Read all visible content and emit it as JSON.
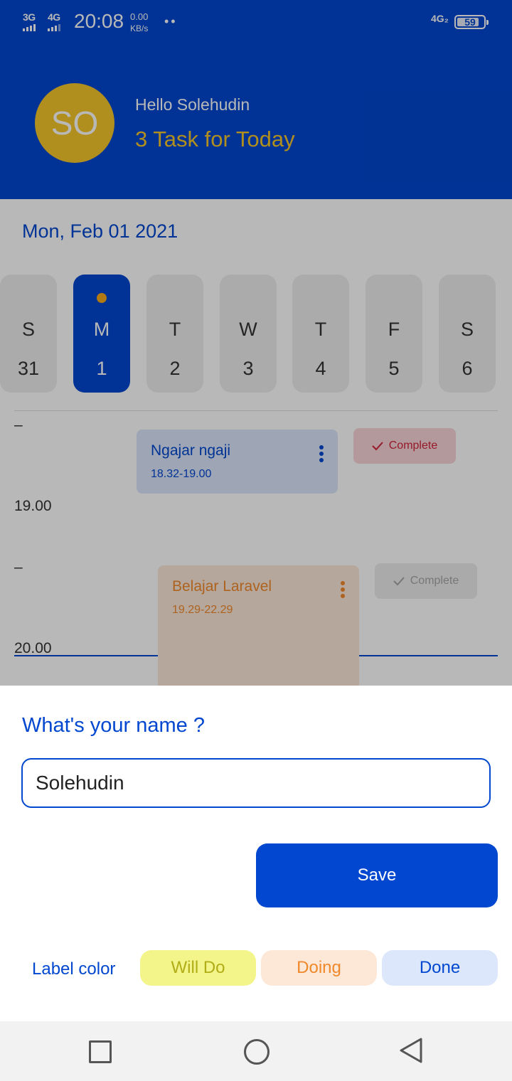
{
  "status_bar": {
    "network1": "3G",
    "network2": "4G",
    "time": "20:08",
    "speed_value": "0.00",
    "speed_unit": "KB/s",
    "dots": "••",
    "network_right": "4G₂",
    "battery": "59"
  },
  "header": {
    "avatar_initials": "SO",
    "greeting": "Hello Solehudin",
    "task_count_text": "3 Task for Today",
    "avatar_color": "#f6c62a",
    "background_color": "#0147cf"
  },
  "calendar": {
    "date_title": "Mon, Feb 01 2021",
    "days": [
      {
        "name": "S",
        "date": "31",
        "active": false
      },
      {
        "name": "M",
        "date": "1",
        "active": true
      },
      {
        "name": "T",
        "date": "2",
        "active": false
      },
      {
        "name": "W",
        "date": "3",
        "active": false
      },
      {
        "name": "T",
        "date": "4",
        "active": false
      },
      {
        "name": "F",
        "date": "5",
        "active": false
      },
      {
        "name": "S",
        "date": "6",
        "active": false
      }
    ]
  },
  "timeline": {
    "dash1": "–",
    "label_19": "19.00",
    "dash2": "–",
    "label_20": "20.00"
  },
  "tasks": [
    {
      "title": "Ngajar ngaji",
      "time": "18.32-19.00",
      "status_label": "Complete",
      "color": "#0147cf"
    },
    {
      "title": "Belajar Laravel",
      "time": "19.29-22.29",
      "status_label": "Complete",
      "color": "#f0892b"
    }
  ],
  "dialog": {
    "question": "What's your name ?",
    "name_value": "Solehudin",
    "save_label": "Save",
    "label_color_text": "Label color",
    "chips": {
      "will_do": "Will Do",
      "doing": "Doing",
      "done": "Done"
    }
  },
  "icons": {
    "checkmark": "check-icon",
    "more": "more-vertical-icon",
    "nav_recent": "square-icon",
    "nav_home": "circle-icon",
    "nav_back": "triangle-back-icon"
  }
}
